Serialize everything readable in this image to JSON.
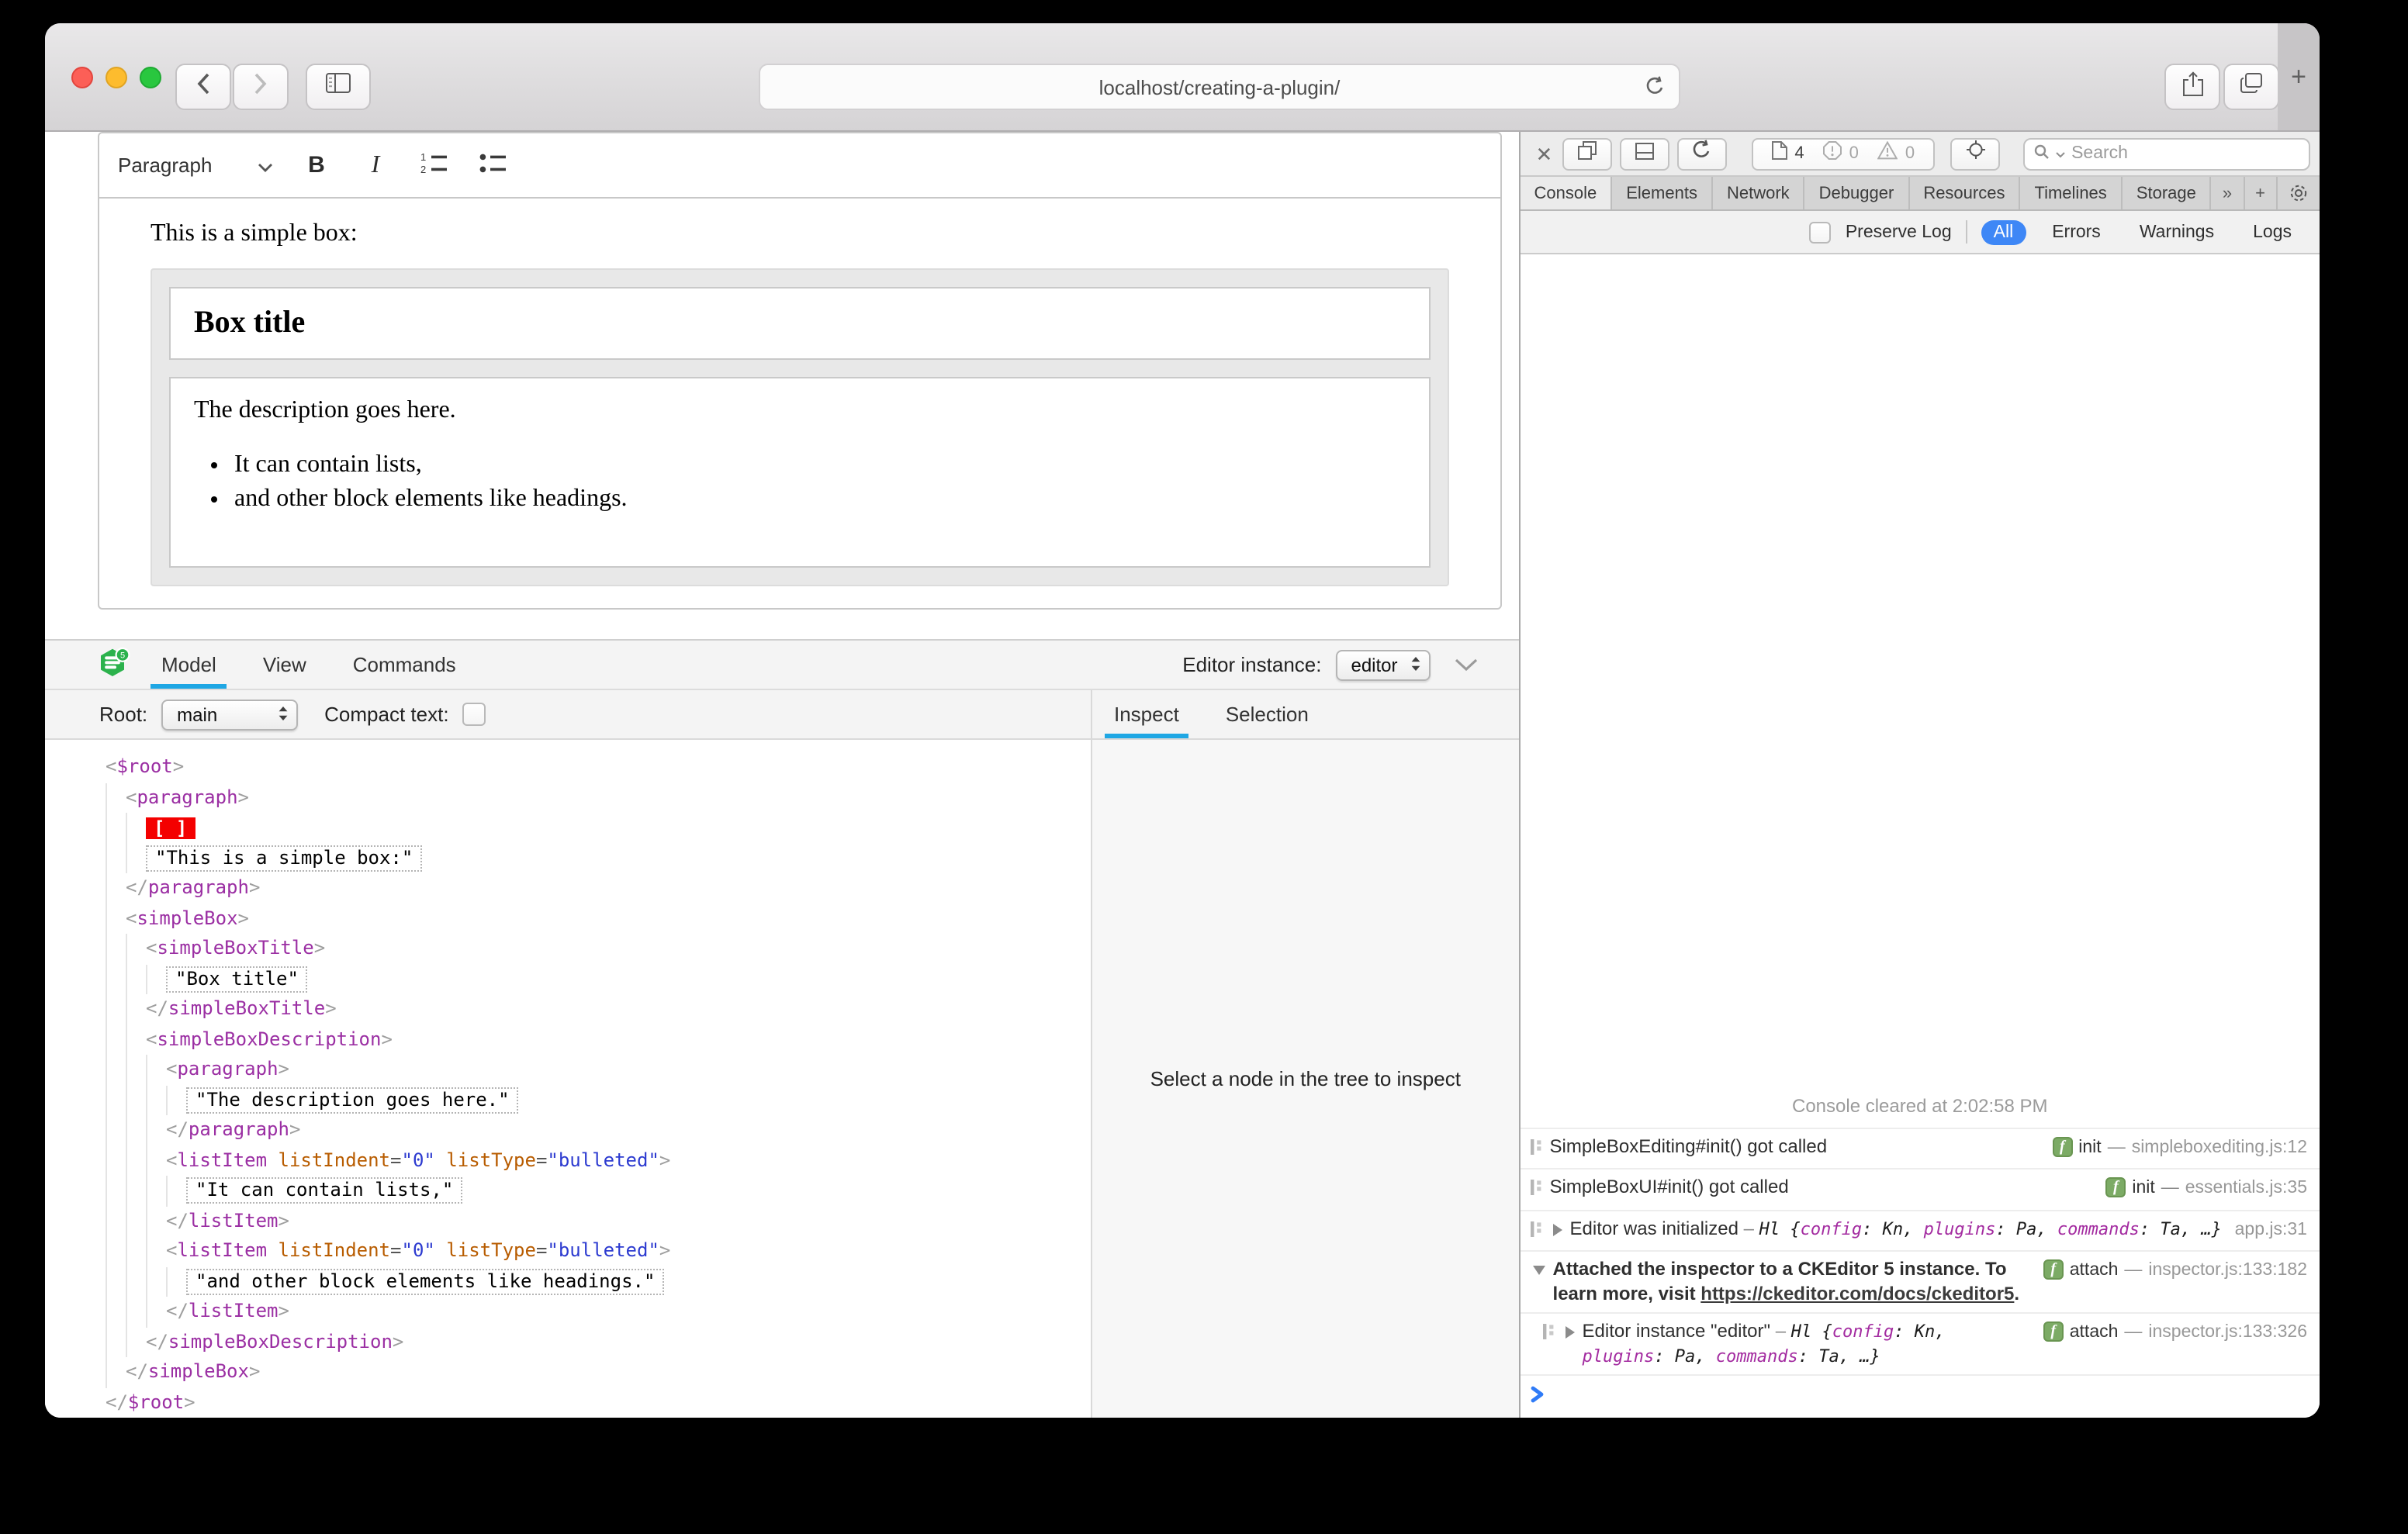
{
  "browser": {
    "url": "localhost/creating-a-plugin/"
  },
  "editor": {
    "toolbar": {
      "paragraph": "Paragraph"
    },
    "content": {
      "intro": "This is a simple box:",
      "box_title": "Box title",
      "description": "The description goes here.",
      "list": [
        "It can contain lists,",
        "and other block elements like headings."
      ]
    }
  },
  "ck": {
    "tabs": [
      {
        "label": "Model",
        "active": true
      },
      {
        "label": "View",
        "active": false
      },
      {
        "label": "Commands",
        "active": false
      }
    ],
    "editor_instance_label": "Editor instance:",
    "editor_instance_value": "editor",
    "root_label": "Root:",
    "root_value": "main",
    "compact_label": "Compact text:",
    "side_tabs": [
      {
        "label": "Inspect",
        "active": true
      },
      {
        "label": "Selection",
        "active": false
      }
    ],
    "empty_message": "Select a node in the tree to inspect",
    "accent": "#1fa7e4",
    "tree": [
      {
        "k": "open",
        "level": 0,
        "name": "$root"
      },
      {
        "k": "open",
        "level": 1,
        "name": "paragraph"
      },
      {
        "k": "selection",
        "level": 2,
        "label": "[ ]"
      },
      {
        "k": "text",
        "level": 2,
        "value": "\"This is a simple box:\""
      },
      {
        "k": "close",
        "level": 1,
        "name": "paragraph"
      },
      {
        "k": "open",
        "level": 1,
        "name": "simpleBox"
      },
      {
        "k": "open",
        "level": 2,
        "name": "simpleBoxTitle"
      },
      {
        "k": "text",
        "level": 3,
        "value": "\"Box title\""
      },
      {
        "k": "close",
        "level": 2,
        "name": "simpleBoxTitle"
      },
      {
        "k": "open",
        "level": 2,
        "name": "simpleBoxDescription"
      },
      {
        "k": "open",
        "level": 3,
        "name": "paragraph"
      },
      {
        "k": "text",
        "level": 4,
        "value": "\"The description goes here.\""
      },
      {
        "k": "close",
        "level": 3,
        "name": "paragraph"
      },
      {
        "k": "open",
        "level": 3,
        "name": "listItem",
        "attrs": [
          {
            "n": "listIndent",
            "v": "0"
          },
          {
            "n": "listType",
            "v": "bulleted"
          }
        ]
      },
      {
        "k": "text",
        "level": 4,
        "value": "\"It can contain lists,\""
      },
      {
        "k": "close",
        "level": 3,
        "name": "listItem"
      },
      {
        "k": "open",
        "level": 3,
        "name": "listItem",
        "attrs": [
          {
            "n": "listIndent",
            "v": "0"
          },
          {
            "n": "listType",
            "v": "bulleted"
          }
        ]
      },
      {
        "k": "text",
        "level": 4,
        "value": "\"and other block elements like headings.\""
      },
      {
        "k": "close",
        "level": 3,
        "name": "listItem"
      },
      {
        "k": "close",
        "level": 2,
        "name": "simpleBoxDescription"
      },
      {
        "k": "close",
        "level": 1,
        "name": "simpleBox"
      },
      {
        "k": "close",
        "level": 0,
        "name": "$root"
      }
    ]
  },
  "wi": {
    "page_count": "4",
    "error_count": "0",
    "warning_count": "0",
    "search_placeholder": "Search",
    "tabs": [
      "Console",
      "Elements",
      "Network",
      "Debugger",
      "Resources",
      "Timelines",
      "Storage"
    ],
    "active_tab": "Console",
    "filter": {
      "preserve": "Preserve Log",
      "scopes": [
        "All",
        "Errors",
        "Warnings",
        "Logs"
      ],
      "active_scope": "All",
      "accent": "#3e87f6"
    },
    "cleared": "Console cleared at 2:02:58 PM",
    "messages": [
      {
        "icon": true,
        "text": "SimpleBoxEditing#init() got called",
        "badge": "init",
        "loc": "simpleboxediting.js:12"
      },
      {
        "icon": true,
        "text": "SimpleBoxUI#init() got called",
        "badge": "init",
        "loc": "essentials.js:35"
      },
      {
        "icon": true,
        "tri": "closed",
        "text": "Editor was initialized",
        "obj": {
          "cls": "Hl",
          "props": [
            [
              "config",
              "Kn"
            ],
            [
              "plugins",
              "Pa"
            ],
            [
              "commands",
              "Ta"
            ]
          ],
          "ellipsis": "…"
        },
        "loc": "app.js:31"
      },
      {
        "tri": "open",
        "bold": true,
        "text": "Attached the inspector to a CKEditor 5 instance. To learn more, visit ",
        "link": "https://ckeditor.com/docs/ckeditor5",
        "after": ".",
        "badge": "attach",
        "loc": "inspector.js:133:182"
      },
      {
        "icon": true,
        "tri": "closed",
        "indent": true,
        "text": "Editor instance \"editor\"",
        "obj": {
          "cls": "Hl",
          "props": [
            [
              "config",
              "Kn"
            ],
            [
              "plugins",
              "Pa"
            ],
            [
              "commands",
              "Ta"
            ]
          ],
          "ellipsis": "…"
        },
        "badge": "attach",
        "loc": "inspector.js:133:326"
      }
    ]
  }
}
